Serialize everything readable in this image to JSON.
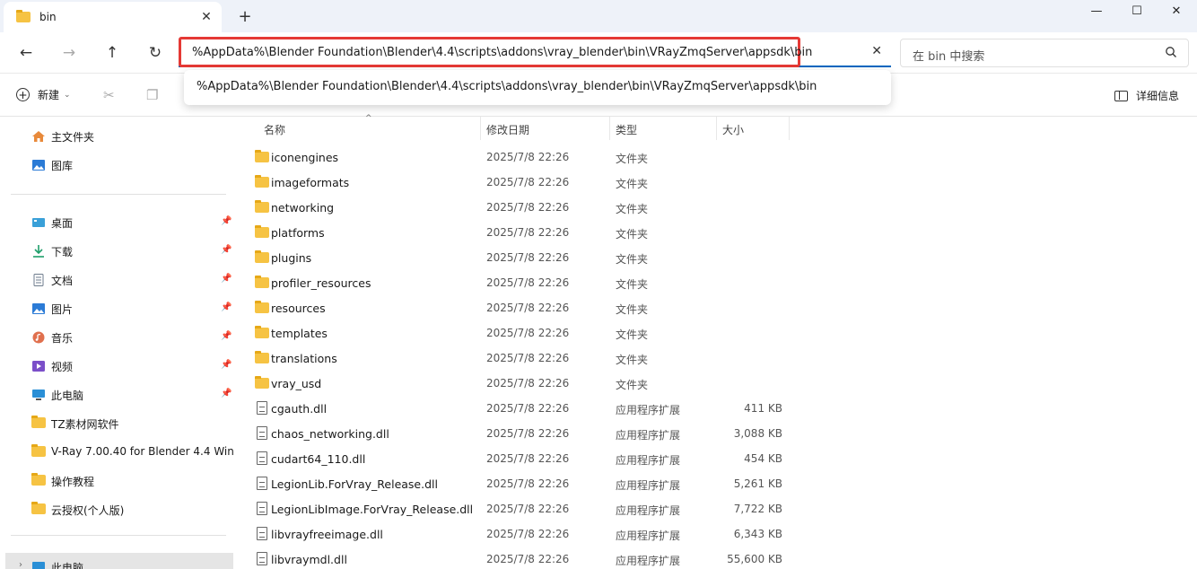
{
  "window": {
    "tab_title": "bin",
    "new_tab": "+",
    "minimize": "—",
    "maximize": "☐",
    "close": "✕"
  },
  "nav": {
    "back_icon": "arrow-left-icon",
    "forward_icon": "arrow-right-icon",
    "up_icon": "arrow-up-icon",
    "refresh_icon": "refresh-icon",
    "address_value": "%AppData%\\Blender Foundation\\Blender\\4.4\\scripts\\addons\\vray_blender\\bin\\VRayZmqServer\\appsdk\\bin",
    "search_placeholder": "在 bin 中搜索"
  },
  "dropdown": {
    "suggestion": "%AppData%\\Blender Foundation\\Blender\\4.4\\scripts\\addons\\vray_blender\\bin\\VRayZmqServer\\appsdk\\bin"
  },
  "toolbar": {
    "new_label": "新建",
    "details_label": "详细信息"
  },
  "sidebar": {
    "top": [
      {
        "label": "主文件夹",
        "icon": "home-icon"
      },
      {
        "label": "图库",
        "icon": "gallery-icon"
      }
    ],
    "pinned": [
      {
        "label": "桌面",
        "icon": "desktop-icon"
      },
      {
        "label": "下载",
        "icon": "download-icon"
      },
      {
        "label": "文档",
        "icon": "document-icon"
      },
      {
        "label": "图片",
        "icon": "pictures-icon"
      },
      {
        "label": "音乐",
        "icon": "music-icon"
      },
      {
        "label": "视频",
        "icon": "video-icon"
      },
      {
        "label": "此电脑",
        "icon": "computer-icon"
      }
    ],
    "folders": [
      {
        "label": "TZ素材网软件"
      },
      {
        "label": "V-Ray 7.00.40 for Blender 4.4 Win"
      },
      {
        "label": "操作教程"
      },
      {
        "label": "云授权(个人版)"
      }
    ],
    "bottom": {
      "label": "此电脑"
    }
  },
  "columns": {
    "name": "名称",
    "date": "修改日期",
    "type": "类型",
    "size": "大小"
  },
  "files": [
    {
      "name": "iconengines",
      "date": "2025/7/8 22:26",
      "type": "文件夹",
      "size": "",
      "kind": "folder"
    },
    {
      "name": "imageformats",
      "date": "2025/7/8 22:26",
      "type": "文件夹",
      "size": "",
      "kind": "folder"
    },
    {
      "name": "networking",
      "date": "2025/7/8 22:26",
      "type": "文件夹",
      "size": "",
      "kind": "folder"
    },
    {
      "name": "platforms",
      "date": "2025/7/8 22:26",
      "type": "文件夹",
      "size": "",
      "kind": "folder"
    },
    {
      "name": "plugins",
      "date": "2025/7/8 22:26",
      "type": "文件夹",
      "size": "",
      "kind": "folder"
    },
    {
      "name": "profiler_resources",
      "date": "2025/7/8 22:26",
      "type": "文件夹",
      "size": "",
      "kind": "folder"
    },
    {
      "name": "resources",
      "date": "2025/7/8 22:26",
      "type": "文件夹",
      "size": "",
      "kind": "folder"
    },
    {
      "name": "templates",
      "date": "2025/7/8 22:26",
      "type": "文件夹",
      "size": "",
      "kind": "folder"
    },
    {
      "name": "translations",
      "date": "2025/7/8 22:26",
      "type": "文件夹",
      "size": "",
      "kind": "folder"
    },
    {
      "name": "vray_usd",
      "date": "2025/7/8 22:26",
      "type": "文件夹",
      "size": "",
      "kind": "folder"
    },
    {
      "name": "cgauth.dll",
      "date": "2025/7/8 22:26",
      "type": "应用程序扩展",
      "size": "411 KB",
      "kind": "dll"
    },
    {
      "name": "chaos_networking.dll",
      "date": "2025/7/8 22:26",
      "type": "应用程序扩展",
      "size": "3,088 KB",
      "kind": "dll"
    },
    {
      "name": "cudart64_110.dll",
      "date": "2025/7/8 22:26",
      "type": "应用程序扩展",
      "size": "454 KB",
      "kind": "dll"
    },
    {
      "name": "LegionLib.ForVray_Release.dll",
      "date": "2025/7/8 22:26",
      "type": "应用程序扩展",
      "size": "5,261 KB",
      "kind": "dll"
    },
    {
      "name": "LegionLibImage.ForVray_Release.dll",
      "date": "2025/7/8 22:26",
      "type": "应用程序扩展",
      "size": "7,722 KB",
      "kind": "dll"
    },
    {
      "name": "libvrayfreeimage.dll",
      "date": "2025/7/8 22:26",
      "type": "应用程序扩展",
      "size": "6,343 KB",
      "kind": "dll"
    },
    {
      "name": "libvraymdl.dll",
      "date": "2025/7/8 22:26",
      "type": "应用程序扩展",
      "size": "55,600 KB",
      "kind": "dll"
    }
  ],
  "colors": {
    "highlight_border": "#e53935",
    "folder": "#f6c343",
    "accent": "#0067c0"
  }
}
